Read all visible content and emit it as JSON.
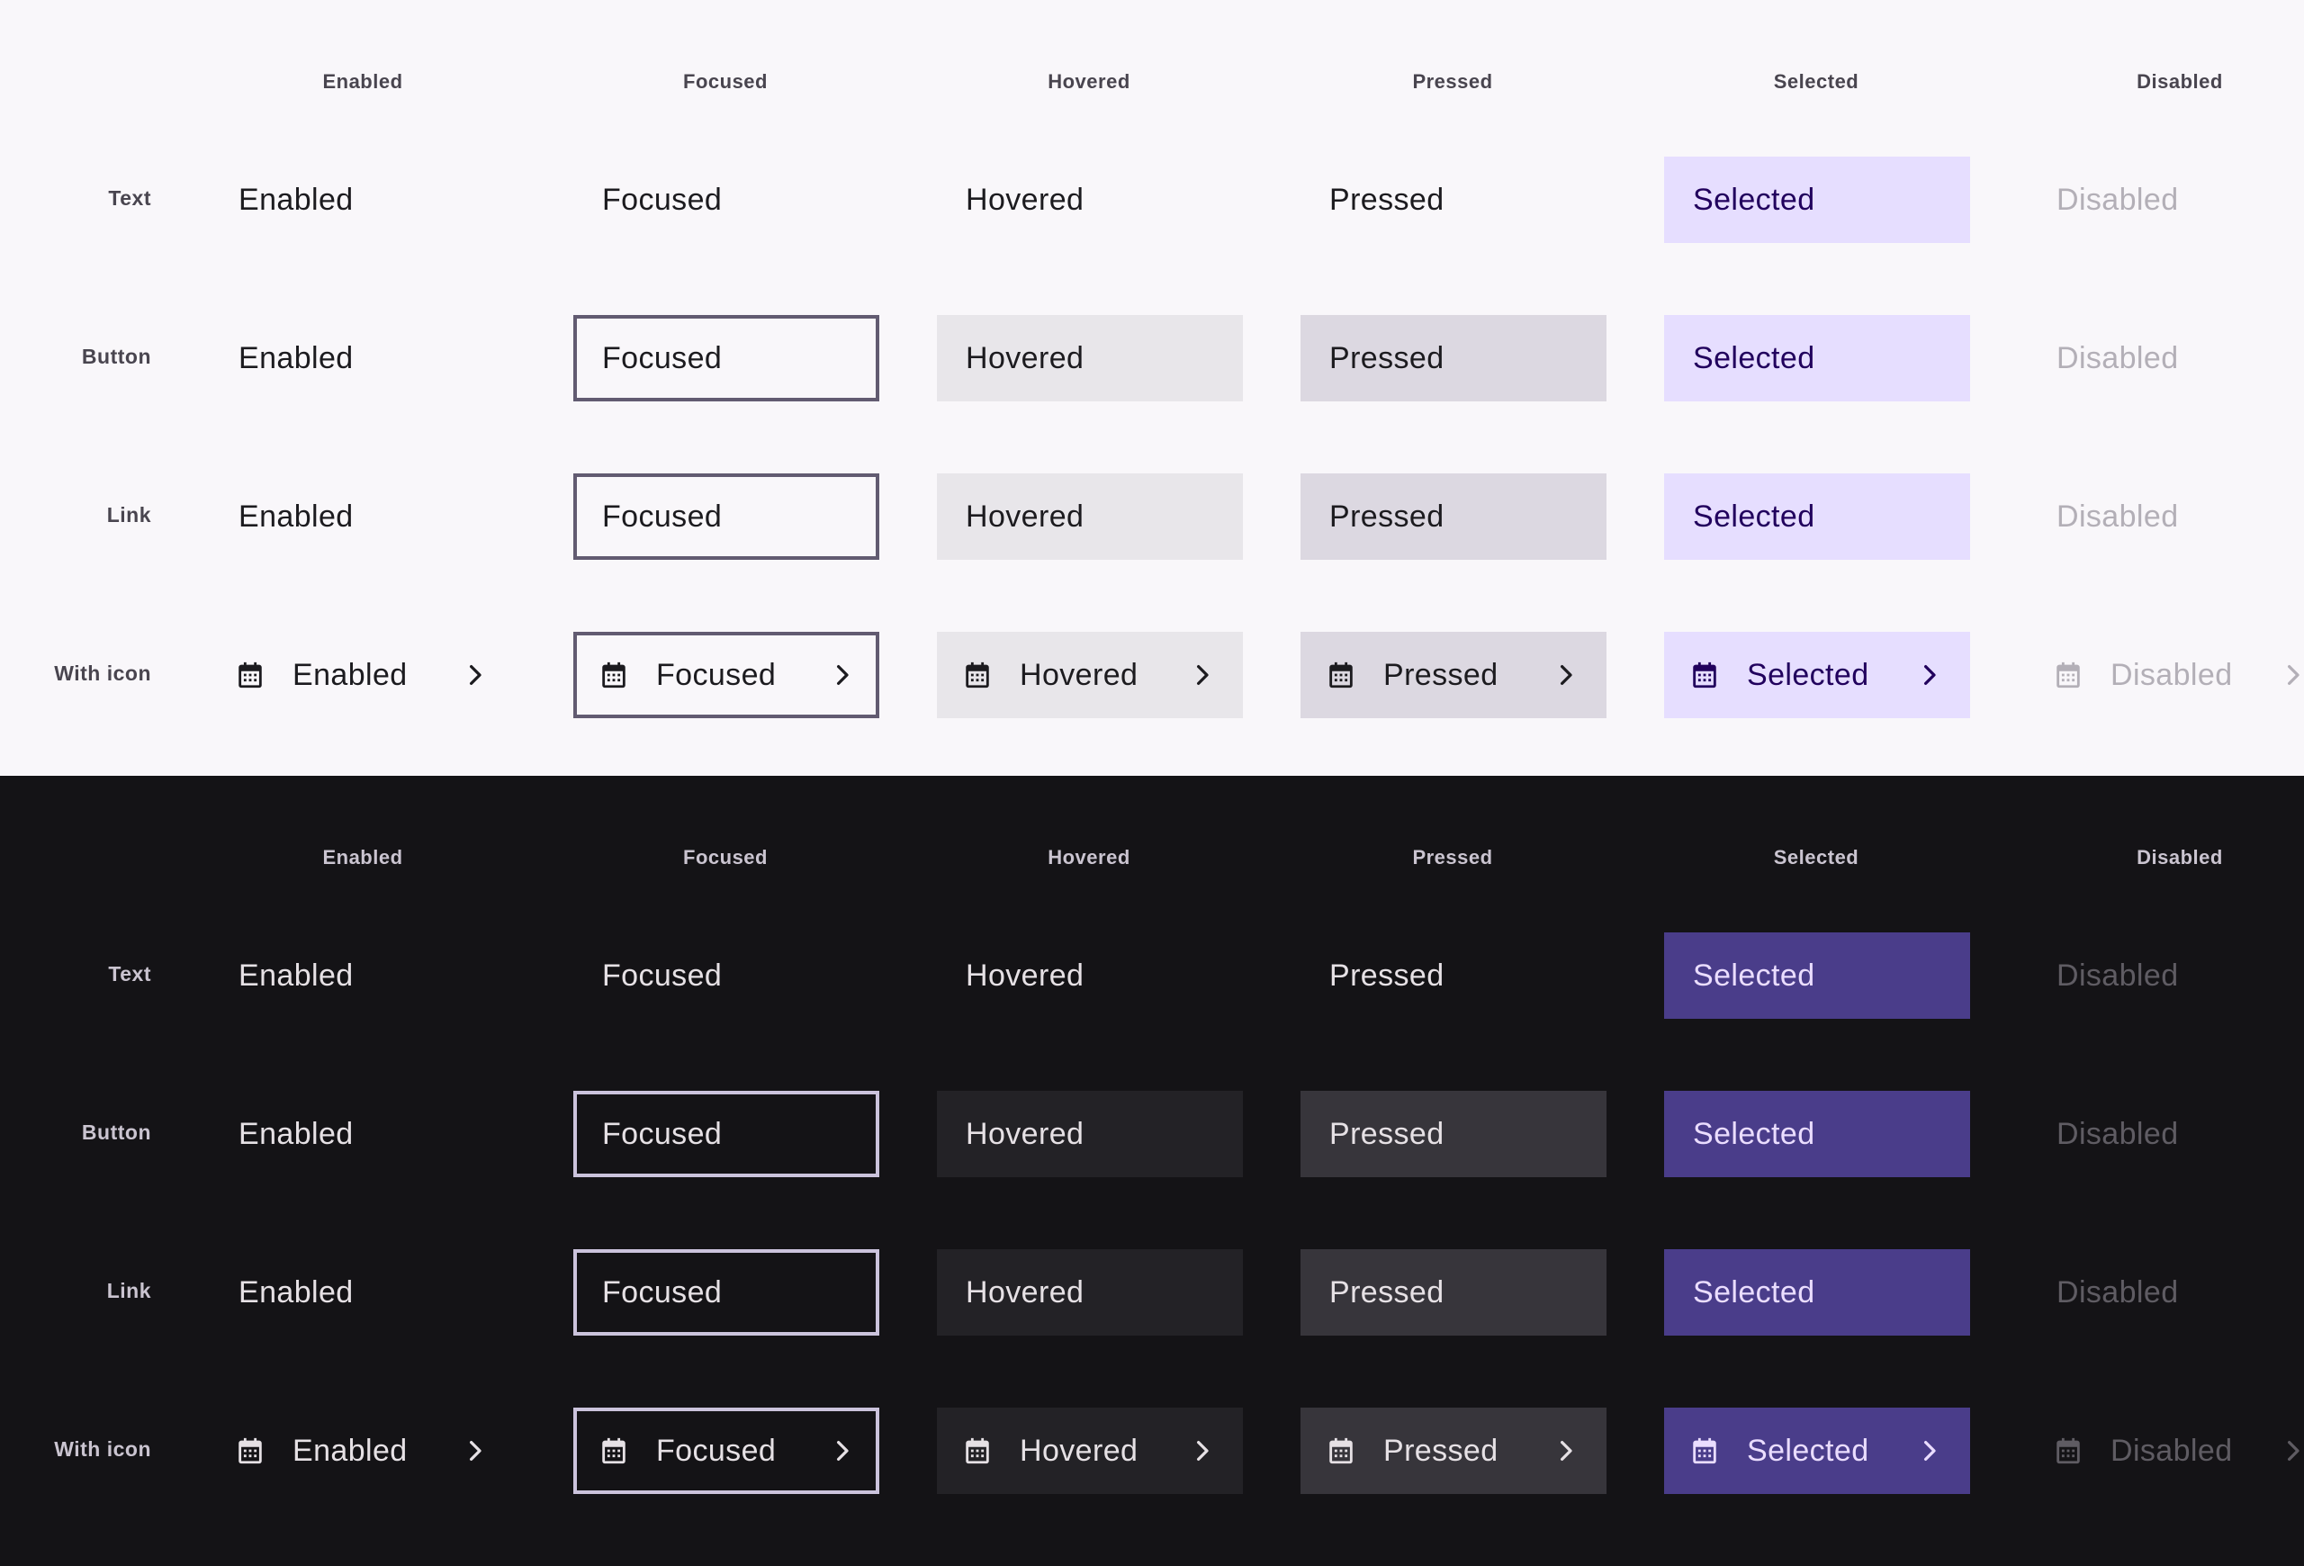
{
  "colors": {
    "light_background": "#f9f7fa",
    "dark_background": "#141316",
    "light_selected": "#e6deff",
    "dark_selected": "#4a3d8a",
    "light_focus_outline": "#625b71",
    "dark_focus_outline": "#cbc3dc"
  },
  "light": {
    "columns": [
      "Enabled",
      "Focused",
      "Hovered",
      "Pressed",
      "Selected",
      "Disabled"
    ],
    "rows": [
      {
        "label": "Text",
        "cells": [
          "Enabled",
          "Focused",
          "Hovered",
          "Pressed",
          "Selected",
          "Disabled"
        ]
      },
      {
        "label": "Button",
        "cells": [
          "Enabled",
          "Focused",
          "Hovered",
          "Pressed",
          "Selected",
          "Disabled"
        ]
      },
      {
        "label": "Link",
        "cells": [
          "Enabled",
          "Focused",
          "Hovered",
          "Pressed",
          "Selected",
          "Disabled"
        ]
      },
      {
        "label": "With icon",
        "cells": [
          "Enabled",
          "Focused",
          "Hovered",
          "Pressed",
          "Selected",
          "Disabled"
        ],
        "icons": [
          "calendar-icon",
          "chevron-right-icon"
        ]
      }
    ]
  },
  "dark": {
    "columns": [
      "Enabled",
      "Focused",
      "Hovered",
      "Pressed",
      "Selected",
      "Disabled"
    ],
    "rows": [
      {
        "label": "Text",
        "cells": [
          "Enabled",
          "Focused",
          "Hovered",
          "Pressed",
          "Selected",
          "Disabled"
        ]
      },
      {
        "label": "Button",
        "cells": [
          "Enabled",
          "Focused",
          "Hovered",
          "Pressed",
          "Selected",
          "Disabled"
        ]
      },
      {
        "label": "Link",
        "cells": [
          "Enabled",
          "Focused",
          "Hovered",
          "Pressed",
          "Selected",
          "Disabled"
        ]
      },
      {
        "label": "With icon",
        "cells": [
          "Enabled",
          "Focused",
          "Hovered",
          "Pressed",
          "Selected",
          "Disabled"
        ],
        "icons": [
          "calendar-icon",
          "chevron-right-icon"
        ]
      }
    ]
  }
}
